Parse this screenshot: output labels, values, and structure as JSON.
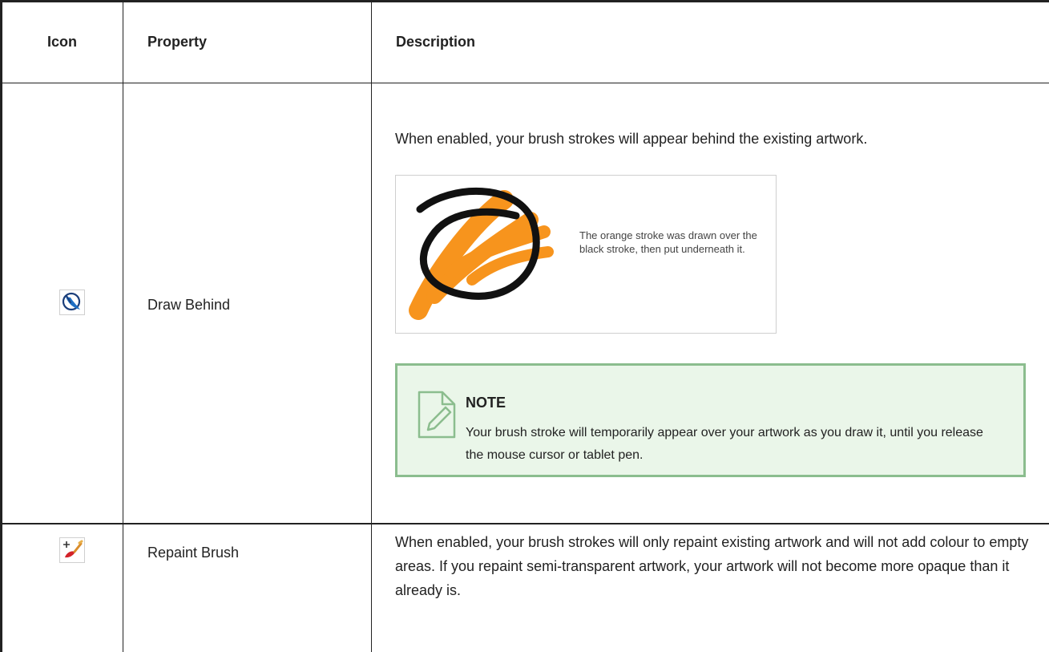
{
  "table": {
    "headers": {
      "icon": "Icon",
      "property": "Property",
      "description": "Description"
    },
    "rows": [
      {
        "icon": "draw-behind-icon",
        "property": "Draw Behind",
        "description": "When enabled, your brush strokes will appear behind the existing artwork.",
        "figure": {
          "caption": "The orange stroke was drawn over the black stroke, then put underneath it."
        },
        "note": {
          "title": "NOTE",
          "body": "Your brush stroke will temporarily appear over your artwork as you draw it, until you release the mouse cursor or tablet pen."
        }
      },
      {
        "icon": "repaint-brush-icon",
        "property": "Repaint Brush",
        "description": "When enabled, your brush strokes will only repaint existing artwork and will not add colour to empty areas. If you repaint semi-transparent artwork, your artwork will not become more opaque than it already is."
      }
    ]
  },
  "colors": {
    "border": "#222222",
    "note_background": "#eaf6e9",
    "note_border": "#8bbd8e",
    "stroke_orange": "#f7941d",
    "stroke_black": "#111111"
  }
}
